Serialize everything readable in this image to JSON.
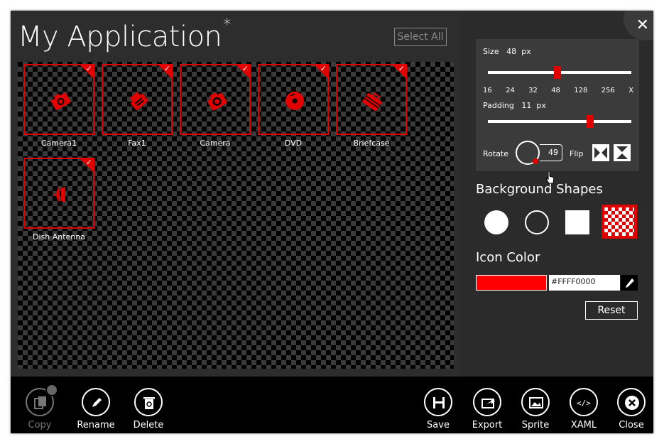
{
  "header": {
    "title": "My Application",
    "modified_marker": "*",
    "select_all_label": "Select All"
  },
  "icons": [
    {
      "label": "Camera1",
      "icon": "camera1-icon"
    },
    {
      "label": "Fax1",
      "icon": "fax-icon"
    },
    {
      "label": "Camera",
      "icon": "camera-icon"
    },
    {
      "label": "DVD",
      "icon": "dvd-icon"
    },
    {
      "label": "Briefcase",
      "icon": "briefcase-icon"
    },
    {
      "label": "Dish Antenna",
      "icon": "dish-antenna-icon"
    }
  ],
  "settings": {
    "size_label": "Size",
    "size_value": "48",
    "size_unit": "px",
    "size_ticks": [
      "16",
      "24",
      "32",
      "48",
      "128",
      "256",
      "X"
    ],
    "padding_label": "Padding",
    "padding_value": "11",
    "padding_unit": "px",
    "rotate_label": "Rotate",
    "rotate_value": "49",
    "flip_label": "Flip"
  },
  "background_shapes": {
    "title": "Background Shapes",
    "selected": "checker"
  },
  "icon_color": {
    "title": "Icon Color",
    "hex": "#FFFF0000",
    "swatch": "#ff0000"
  },
  "reset_label": "Reset",
  "appbar": {
    "copy": "Copy",
    "rename": "Rename",
    "delete": "Delete",
    "save": "Save",
    "export": "Export",
    "sprite": "Sprite",
    "xaml": "XAML",
    "close": "Close"
  },
  "colors": {
    "accent": "#e00000",
    "background": "#2b2b2b",
    "appbar": "#000000"
  }
}
